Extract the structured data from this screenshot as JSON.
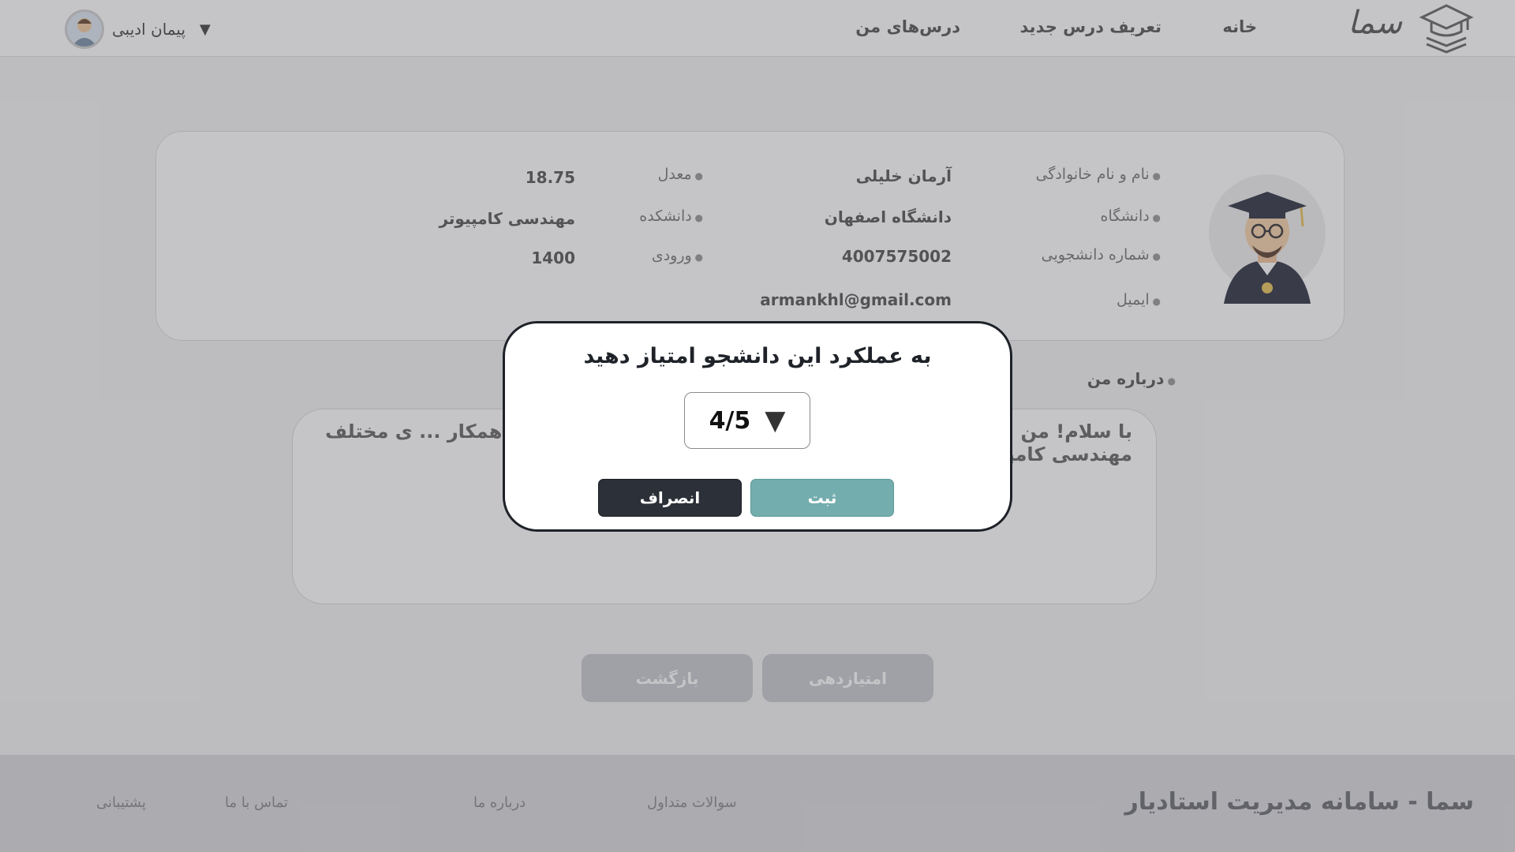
{
  "header": {
    "logo_text": "سما",
    "nav": {
      "home": "خانه",
      "new_course": "تعریف درس جدید",
      "my_courses": "درس‌های من"
    },
    "user": {
      "name": "پیمان ادیبی",
      "caret": "▼"
    }
  },
  "profile": {
    "full_name": {
      "label": "نام و نام خانوادگی",
      "value": "آرمان خلیلی"
    },
    "university": {
      "label": "دانشگاه",
      "value": "دانشگاه اصفهان"
    },
    "student_id": {
      "label": "شماره دانشجویی",
      "value": "4007575002"
    },
    "email": {
      "label": "ایمیل",
      "value": "armankhl@gmail.com"
    },
    "gpa": {
      "label": "معدل",
      "value": "18.75"
    },
    "faculty": {
      "label": "دانشکده",
      "value": "مهندسی کامپیوتر"
    },
    "entry_year": {
      "label": "ورودی",
      "value": "1400"
    }
  },
  "about": {
    "title": "درباره من",
    "text": "با سلام! من ... عی هستم. انضباط برای من ... و متعهد هستم که با همکار ... ی مختلف مهندسی کامپیوتر بر ... رفت در این حوزه هستید، خوش ..."
  },
  "actions": {
    "back": "بازگشت",
    "rate": "امتیازدهی"
  },
  "footer": {
    "title": "سما - سامانه مدیریت استادیار",
    "links": [
      "سوالات متداول",
      "درباره ما",
      "تماس با ما",
      "پشتیبانی"
    ]
  },
  "modal": {
    "title": "به عملکرد این دانشجو امتیاز دهید",
    "rating": {
      "value": "4/5",
      "caret": "▼"
    },
    "submit": "ثبت",
    "cancel": "انصراف"
  },
  "colors": {
    "submit_button": "#74adad",
    "cancel_button": "#2c3038",
    "modal_border": "#1e2228"
  },
  "icons": {
    "logo": "graduation-cap-books-icon",
    "avatar": "user-avatar-icon",
    "student_photo": "graduate-student-illustration"
  }
}
